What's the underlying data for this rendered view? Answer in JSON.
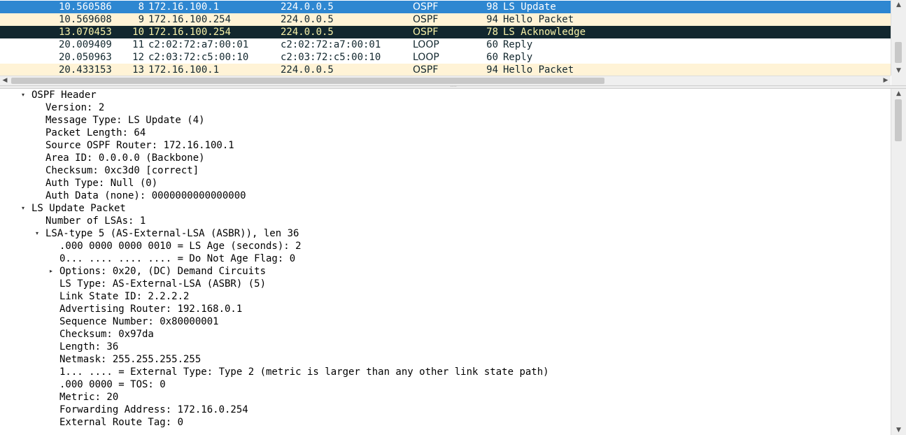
{
  "packet_list": {
    "rows": [
      {
        "no": "8",
        "time": "10.560586",
        "source": "172.16.100.1",
        "destination": "224.0.0.5",
        "protocol": "OSPF",
        "length": "98",
        "info": "LS Update",
        "style": "selected"
      },
      {
        "no": "9",
        "time": "10.569608",
        "source": "172.16.100.254",
        "destination": "224.0.0.5",
        "protocol": "OSPF",
        "length": "94",
        "info": "Hello Packet",
        "style": "ospf"
      },
      {
        "no": "10",
        "time": "13.070453",
        "source": "172.16.100.254",
        "destination": "224.0.0.5",
        "protocol": "OSPF",
        "length": "78",
        "info": "LS Acknowledge",
        "style": "dark"
      },
      {
        "no": "11",
        "time": "20.009409",
        "source": "c2:02:72:a7:00:01",
        "destination": "c2:02:72:a7:00:01",
        "protocol": "LOOP",
        "length": "60",
        "info": "Reply",
        "style": "loop"
      },
      {
        "no": "12",
        "time": "20.050963",
        "source": "c2:03:72:c5:00:10",
        "destination": "c2:03:72:c5:00:10",
        "protocol": "LOOP",
        "length": "60",
        "info": "Reply",
        "style": "loop"
      },
      {
        "no": "13",
        "time": "20.433153",
        "source": "172.16.100.1",
        "destination": "224.0.0.5",
        "protocol": "OSPF",
        "length": "94",
        "info": "Hello Packet",
        "style": "ospf"
      }
    ],
    "colors": {
      "selected_bg": "#2e87d1",
      "ospf_bg": "#fff3d6",
      "dark_bg": "#12272e",
      "dark_fg": "#f7f1a8"
    }
  },
  "details": {
    "rows": [
      {
        "depth": 0,
        "toggle": "expanded",
        "text": "OSPF Header"
      },
      {
        "depth": 1,
        "toggle": "none",
        "text": "Version: 2"
      },
      {
        "depth": 1,
        "toggle": "none",
        "text": "Message Type: LS Update (4)"
      },
      {
        "depth": 1,
        "toggle": "none",
        "text": "Packet Length: 64"
      },
      {
        "depth": 1,
        "toggle": "none",
        "text": "Source OSPF Router: 172.16.100.1"
      },
      {
        "depth": 1,
        "toggle": "none",
        "text": "Area ID: 0.0.0.0 (Backbone)"
      },
      {
        "depth": 1,
        "toggle": "none",
        "text": "Checksum: 0xc3d0 [correct]"
      },
      {
        "depth": 1,
        "toggle": "none",
        "text": "Auth Type: Null (0)"
      },
      {
        "depth": 1,
        "toggle": "none",
        "text": "Auth Data (none): 0000000000000000"
      },
      {
        "depth": 0,
        "toggle": "expanded",
        "text": "LS Update Packet"
      },
      {
        "depth": 1,
        "toggle": "none",
        "text": "Number of LSAs: 1"
      },
      {
        "depth": 1,
        "toggle": "expanded",
        "text": "LSA-type 5 (AS-External-LSA (ASBR)), len 36"
      },
      {
        "depth": 2,
        "toggle": "none",
        "text": ".000 0000 0000 0010 = LS Age (seconds): 2"
      },
      {
        "depth": 2,
        "toggle": "none",
        "text": "0... .... .... .... = Do Not Age Flag: 0"
      },
      {
        "depth": 2,
        "toggle": "collapsed",
        "text": "Options: 0x20, (DC) Demand Circuits"
      },
      {
        "depth": 2,
        "toggle": "none",
        "text": "LS Type: AS-External-LSA (ASBR) (5)"
      },
      {
        "depth": 2,
        "toggle": "none",
        "text": "Link State ID: 2.2.2.2"
      },
      {
        "depth": 2,
        "toggle": "none",
        "text": "Advertising Router: 192.168.0.1"
      },
      {
        "depth": 2,
        "toggle": "none",
        "text": "Sequence Number: 0x80000001"
      },
      {
        "depth": 2,
        "toggle": "none",
        "text": "Checksum: 0x97da"
      },
      {
        "depth": 2,
        "toggle": "none",
        "text": "Length: 36"
      },
      {
        "depth": 2,
        "toggle": "none",
        "text": "Netmask: 255.255.255.255"
      },
      {
        "depth": 2,
        "toggle": "none",
        "text": "1... .... = External Type: Type 2 (metric is larger than any other link state path)"
      },
      {
        "depth": 2,
        "toggle": "none",
        "text": ".000 0000 = TOS: 0"
      },
      {
        "depth": 2,
        "toggle": "none",
        "text": "Metric: 20"
      },
      {
        "depth": 2,
        "toggle": "none",
        "text": "Forwarding Address: 172.16.0.254"
      },
      {
        "depth": 2,
        "toggle": "none",
        "text": "External Route Tag: 0"
      }
    ]
  },
  "icons": {
    "expanded": "▾",
    "collapsed": "▸",
    "scroll_up": "▲",
    "scroll_down": "▼",
    "scroll_left": "◀",
    "scroll_right": "▶",
    "splitter_grip": "·····"
  }
}
